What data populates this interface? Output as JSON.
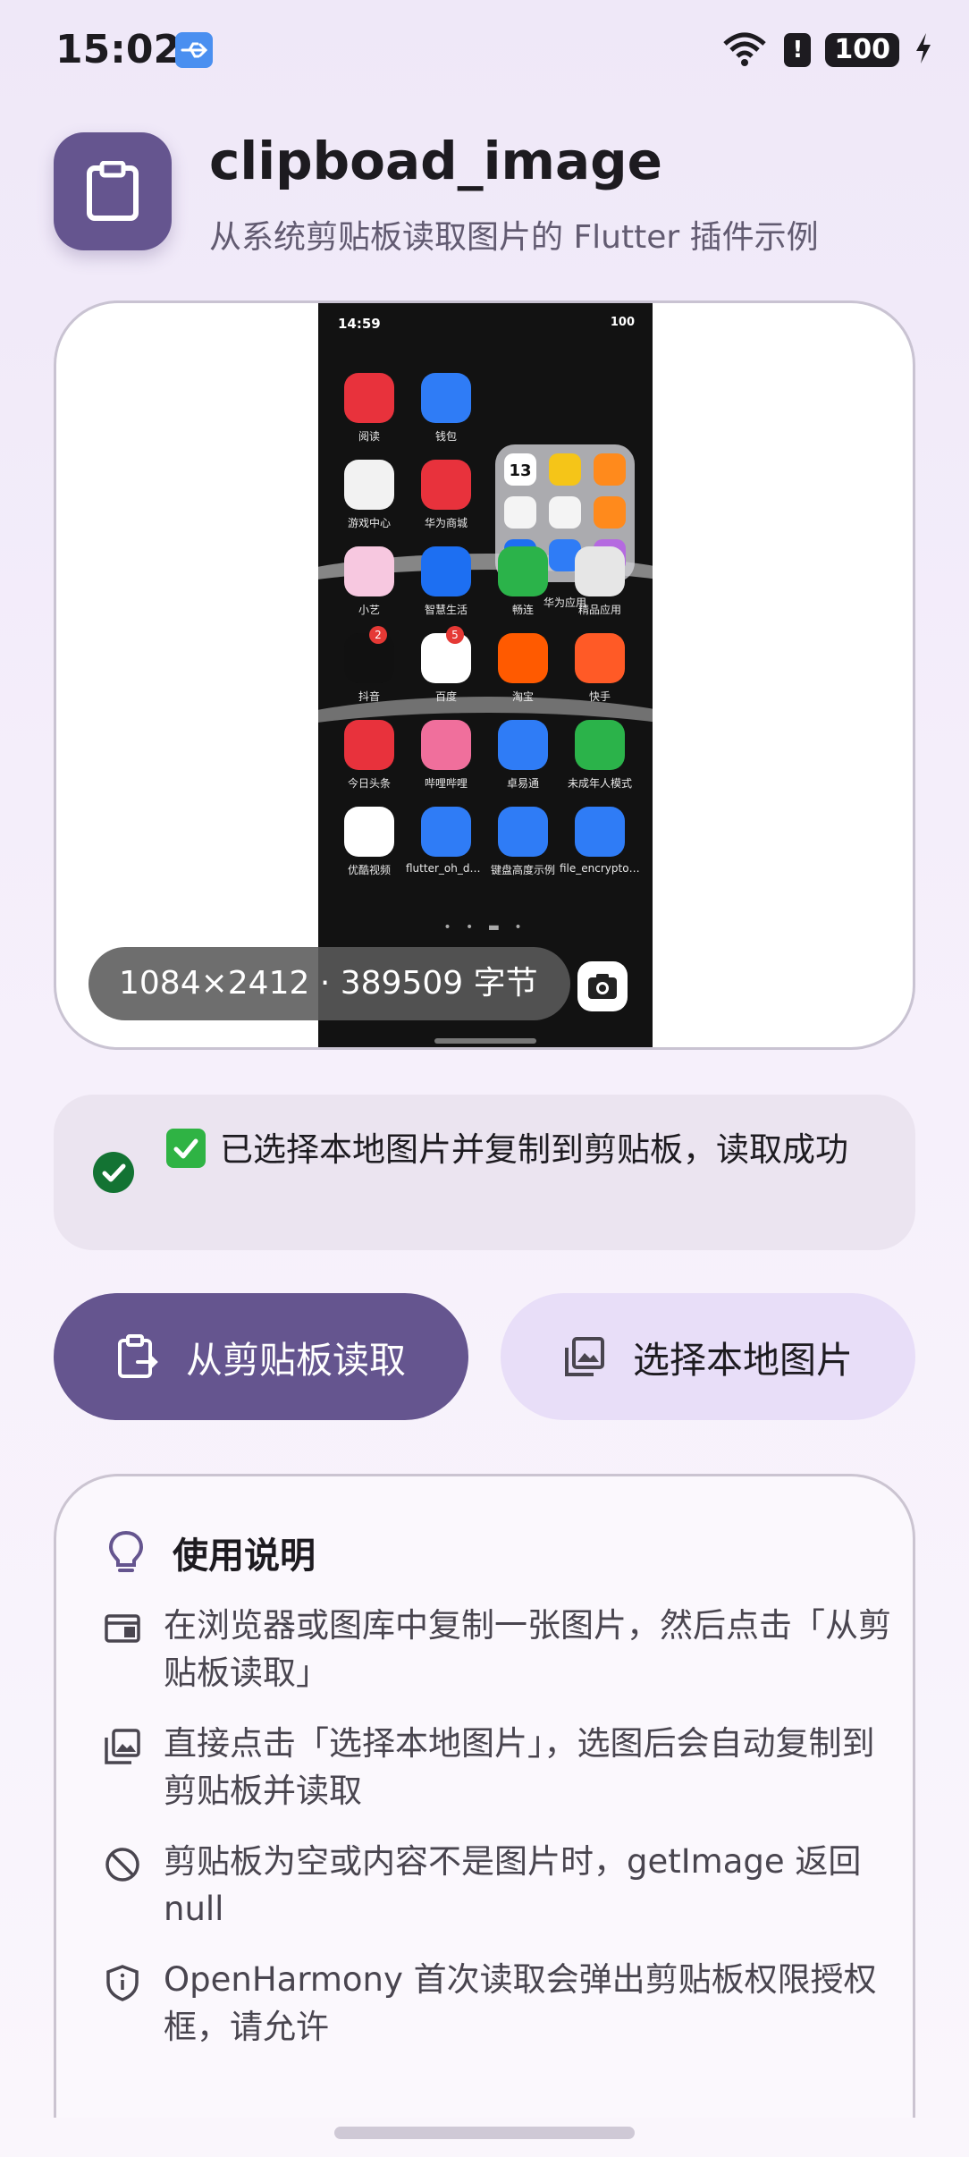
{
  "status_bar": {
    "time": "15:02",
    "battery": "100"
  },
  "header": {
    "title": "clipboad_image",
    "subtitle": "从系统剪贴板读取图片的 Flutter 插件示例"
  },
  "preview": {
    "size_label": "1084×2412 · 389509 字节",
    "screenshot": {
      "time": "14:59",
      "status_right": "100",
      "apps": [
        {
          "label": "阅读",
          "color": "#e8323c"
        },
        {
          "label": "钱包",
          "color": "#2f7cf6"
        },
        {
          "label": "游戏中心",
          "color": "#f2f2f2"
        },
        {
          "label": "华为商城",
          "color": "#e8323c"
        },
        {
          "label": "小艺",
          "color": "#f7c8e0"
        },
        {
          "label": "智慧生活",
          "color": "#1d6ff2"
        },
        {
          "label": "畅连",
          "color": "#2bb34a"
        },
        {
          "label": "精品应用",
          "color": "#e6e6e6"
        },
        {
          "label": "抖音",
          "color": "#111111",
          "badge": "2"
        },
        {
          "label": "百度",
          "color": "#ffffff",
          "badge": "5"
        },
        {
          "label": "淘宝",
          "color": "#ff5a00"
        },
        {
          "label": "快手",
          "color": "#ff5a26"
        },
        {
          "label": "今日头条",
          "color": "#e8323c"
        },
        {
          "label": "哔哩哔哩",
          "color": "#f06f9c"
        },
        {
          "label": "卓易通",
          "color": "#2f7cf6"
        },
        {
          "label": "未成年人模式",
          "color": "#2bb34a"
        },
        {
          "label": "优酷视频",
          "color": "#ffffff"
        },
        {
          "label": "flutter_oh_de...",
          "color": "#2f7cf6"
        },
        {
          "label": "键盘高度示例",
          "color": "#2f7cf6"
        },
        {
          "label": "file_encryptor...",
          "color": "#2f7cf6"
        }
      ],
      "folder_label": "华为应用",
      "folder_date": "13"
    }
  },
  "status_message": {
    "text": "已选择本地图片并复制到剪贴板，读取成功"
  },
  "buttons": {
    "read_clipboard": "从剪贴板读取",
    "pick_local": "选择本地图片"
  },
  "info": {
    "title": "使用说明",
    "items": [
      {
        "icon": "browser-icon",
        "text": "在浏览器或图库中复制一张图片，然后点击「从剪贴板读取」"
      },
      {
        "icon": "image-stack-icon",
        "text": "直接点击「选择本地图片」，选图后会自动复制到剪贴板并读取"
      },
      {
        "icon": "block-icon",
        "text": "剪贴板为空或内容不是图片时，getImage 返回 null"
      },
      {
        "icon": "shield-info-icon",
        "text": "OpenHarmony 首次读取会弹出剪贴板权限授权框，请允许"
      }
    ]
  },
  "colors": {
    "primary": "#65558f",
    "secondary_container": "#e8def8",
    "success": "#137333"
  }
}
